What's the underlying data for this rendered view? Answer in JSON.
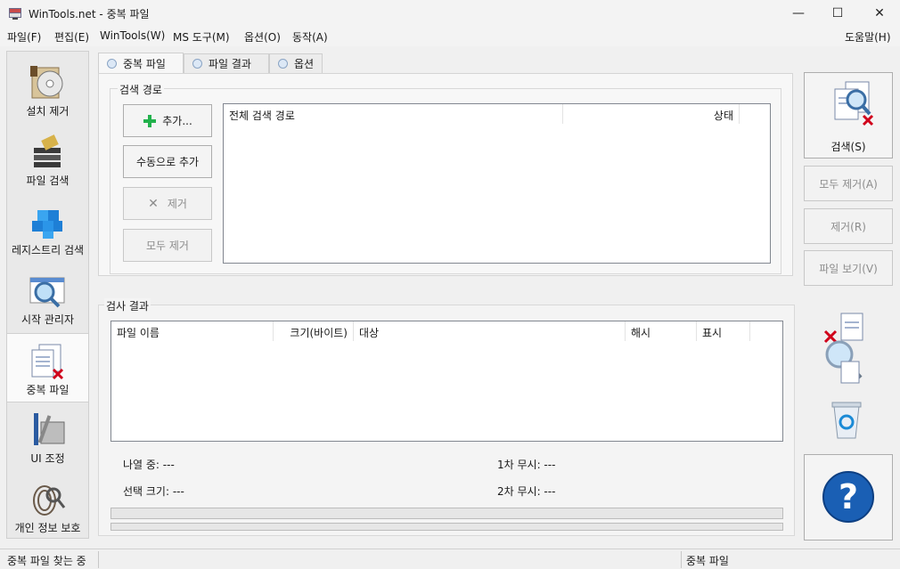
{
  "window": {
    "title": "WinTools.net - 중복 파일",
    "minimize_glyph": "—",
    "maximize_glyph": "☐",
    "close_glyph": "✕"
  },
  "menu": {
    "items": [
      "파일(F)",
      "편집(E)",
      "WinTools(W)",
      "MS 도구(M)",
      "옵션(O)",
      "동작(A)"
    ],
    "help": "도움말(H)"
  },
  "sidebar": {
    "items": [
      {
        "label": "설치 제거",
        "icon": "uninstall-cd-icon"
      },
      {
        "label": "파일 검색",
        "icon": "file-search-icon"
      },
      {
        "label": "레지스트리 검색",
        "icon": "registry-cubes-icon"
      },
      {
        "label": "시작 관리자",
        "icon": "startup-magnifier-icon"
      },
      {
        "label": "중복 파일",
        "icon": "duplicate-files-icon"
      },
      {
        "label": "UI 조정",
        "icon": "ui-tweak-tools-icon"
      },
      {
        "label": "개인 정보 보호",
        "icon": "privacy-fingerprint-icon"
      }
    ],
    "active_index": 4
  },
  "tabs": [
    "중복 파일",
    "파일 결과",
    "옵션"
  ],
  "search_path": {
    "group_title": "검색 경로",
    "add_label": "추가...",
    "manual_add_label": "수동으로 추가",
    "remove_label": "제거",
    "remove_all_label": "모두 제거",
    "columns": [
      "전체 검색 경로",
      "상태"
    ]
  },
  "results": {
    "group_title": "검사 결과",
    "columns": [
      "파일 이름",
      "크기(바이트)",
      "대상",
      "해시",
      "표시"
    ],
    "listed_label": "나열 중: ---",
    "selected_size_label": "선택 크기: ---",
    "first_ignore_label": "1차 무시: ---",
    "second_ignore_label": "2차 무시: ---"
  },
  "right_panel": {
    "search_label": "검색(S)",
    "remove_all_label": "모두 제거(A)",
    "remove_label": "제거(R)",
    "view_file_label": "파일 보기(V)",
    "help_glyph": "?"
  },
  "status": {
    "left": "중복 파일 찾는 중",
    "right": "중복 파일"
  },
  "colors": {
    "accent_blue": "#1a5fb4",
    "add_green": "#22b14c",
    "remove_red": "#d0021b"
  }
}
